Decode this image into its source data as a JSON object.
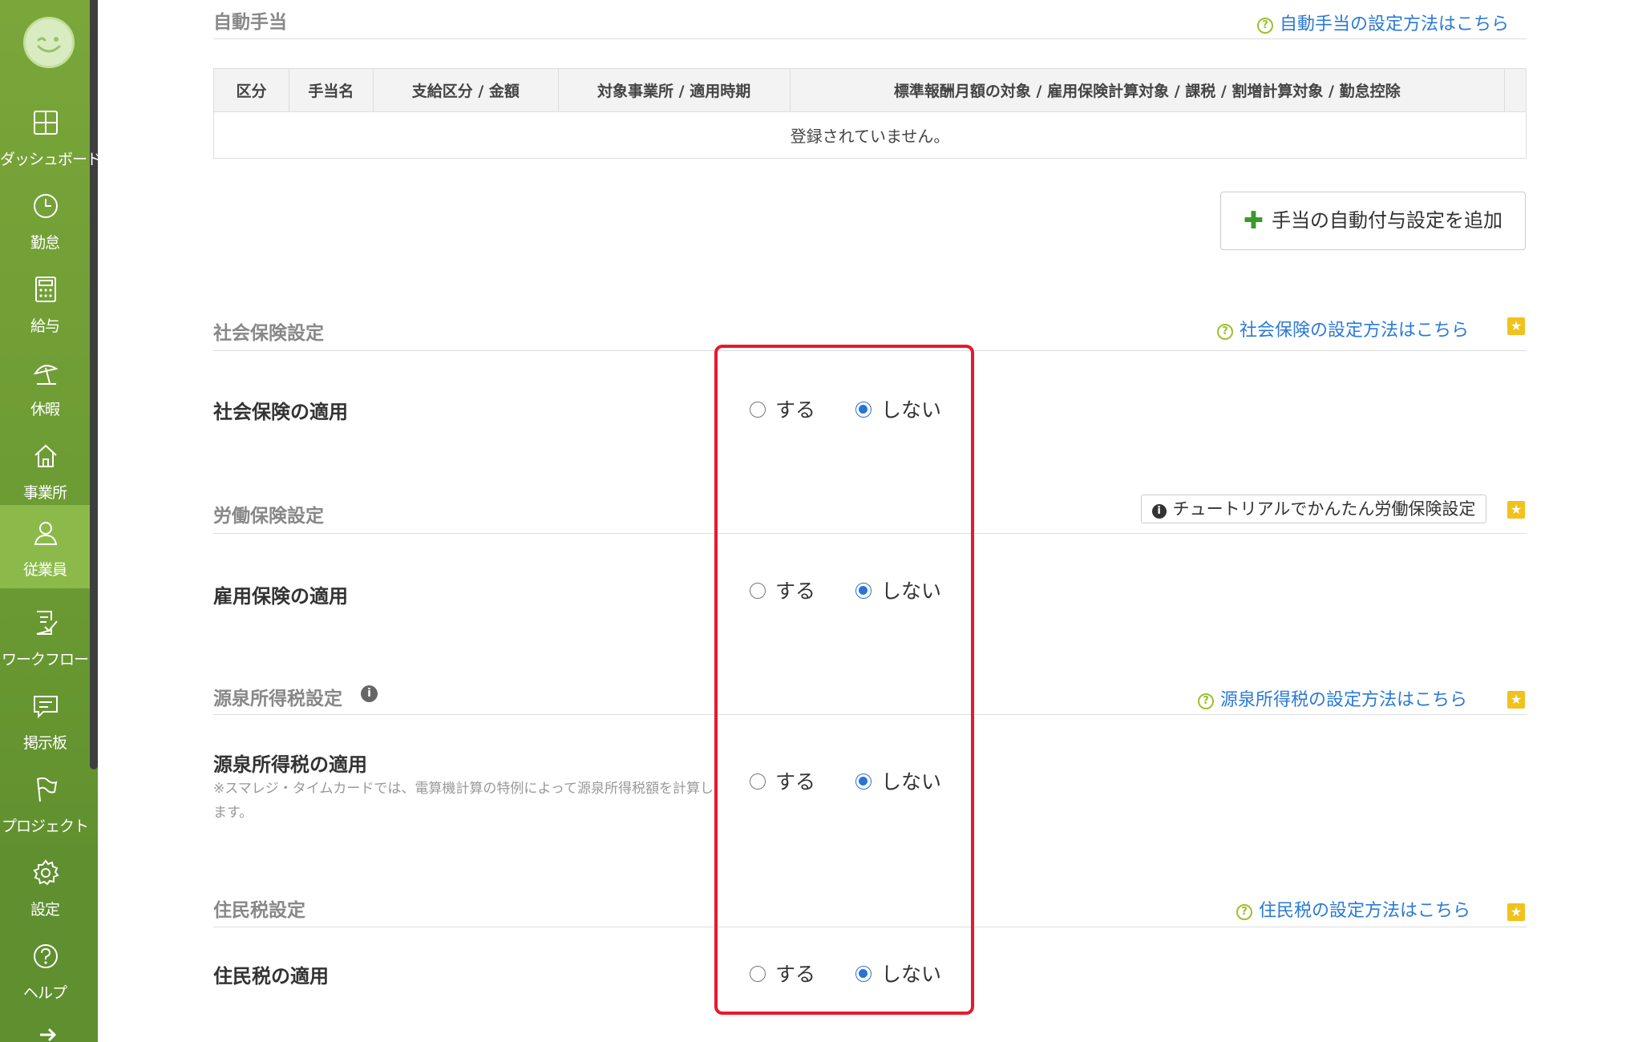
{
  "sidebar": {
    "items": [
      {
        "label": "ダッシュボード",
        "icon": "dashboard-icon"
      },
      {
        "label": "勤怠",
        "icon": "clock-icon"
      },
      {
        "label": "給与",
        "icon": "calculator-icon"
      },
      {
        "label": "休暇",
        "icon": "beach-umbrella-icon"
      },
      {
        "label": "事業所",
        "icon": "home-icon"
      },
      {
        "label": "従業員",
        "icon": "person-icon"
      },
      {
        "label": "ワークフロー",
        "icon": "workflow-icon"
      },
      {
        "label": "掲示板",
        "icon": "message-board-icon"
      },
      {
        "label": "プロジェクト",
        "icon": "flag-icon"
      },
      {
        "label": "設定",
        "icon": "gear-icon"
      },
      {
        "label": "ヘルプ",
        "icon": "help-icon"
      }
    ],
    "active": "従業員"
  },
  "auto_allowance": {
    "title": "自動手当",
    "help_link": "自動手当の設定方法はこちら",
    "table": {
      "headers": [
        "区分",
        "手当名",
        "支給区分 / 金額",
        "対象事業所 / 適用時期",
        "標準報酬月額の対象 / 雇用保険計算対象 / 課税 / 割増計算対象 / 勤怠控除",
        ""
      ],
      "empty_message": "登録されていません。"
    },
    "add_button": "手当の自動付与設定を追加"
  },
  "social_insurance": {
    "title": "社会保険設定",
    "help_link": "社会保険の設定方法はこちら",
    "row_label": "社会保険の適用",
    "options": [
      "する",
      "しない"
    ],
    "selected": "しない"
  },
  "labor_insurance": {
    "title": "労働保険設定",
    "tutorial_button": "チュートリアルでかんたん労働保険設定",
    "row_label": "雇用保険の適用",
    "options": [
      "する",
      "しない"
    ],
    "selected": "しない"
  },
  "income_tax": {
    "title": "源泉所得税設定",
    "help_link": "源泉所得税の設定方法はこちら",
    "row_label": "源泉所得税の適用",
    "note": "※スマレジ・タイムカードでは、電算機計算の特例によって源泉所得税額を計算します。",
    "options": [
      "する",
      "しない"
    ],
    "selected": "しない"
  },
  "resident_tax": {
    "title": "住民税設定",
    "help_link": "住民税の設定方法はこちら",
    "row_label": "住民税の適用",
    "options": [
      "する",
      "しない"
    ],
    "selected": "しない"
  },
  "colors": {
    "sidebar_green": "#6b9a33",
    "link_blue": "#2a7ad6",
    "highlight_red": "#e8192c",
    "radio_blue": "#2a73d6",
    "star_yellow": "#f1c21b"
  }
}
